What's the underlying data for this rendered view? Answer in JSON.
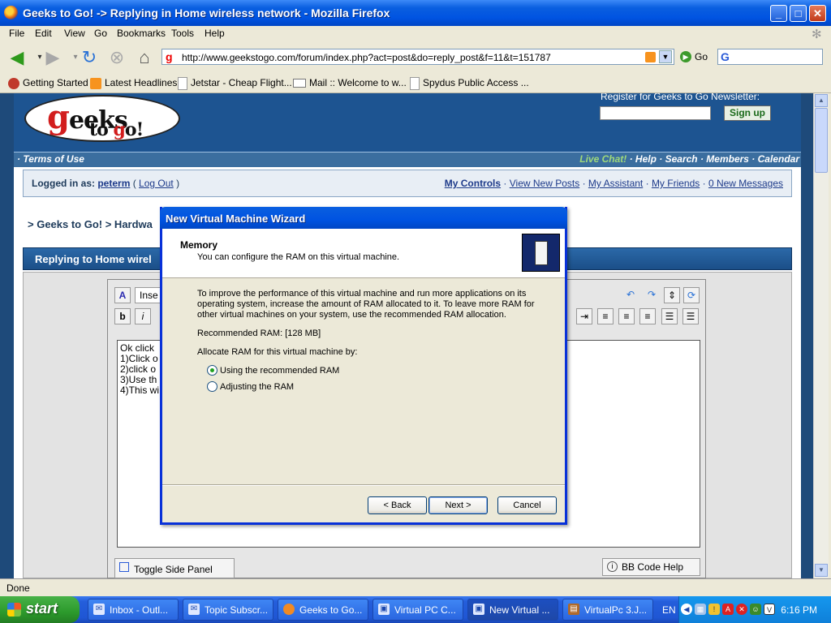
{
  "window": {
    "title": "Geeks to Go! -> Replying in Home wireless network - Mozilla Firefox"
  },
  "menu": [
    "File",
    "Edit",
    "View",
    "Go",
    "Bookmarks",
    "Tools",
    "Help"
  ],
  "nav": {
    "url": "http://www.geekstogo.com/forum/index.php?act=post&do=reply_post&f=11&t=151787",
    "go_label": "Go",
    "search_placeholder": ""
  },
  "bookmarks": [
    {
      "label": "Getting Started",
      "icon": "firefox-icon"
    },
    {
      "label": "Latest Headlines",
      "icon": "rss-icon"
    },
    {
      "label": "Jetstar - Cheap Flight...",
      "icon": "page-icon"
    },
    {
      "label": "Mail :: Welcome to w...",
      "icon": "mail-icon"
    },
    {
      "label": "Spydus Public Access ...",
      "icon": "page-icon"
    }
  ],
  "site": {
    "logo_text": "geeks to go!",
    "newsletter_label": "Register for Geeks to Go Newsletter:",
    "signup": "Sign up",
    "nav_left": "· Terms of Use",
    "nav_live": "Live Chat!",
    "nav_right": " · Help · Search · Members · Calendar",
    "logged_in_prefix": "Logged in as:",
    "username": "peterm",
    "logout": "Log Out",
    "controls": [
      "My Controls",
      "View New Posts",
      "My Assistant",
      "My Friends",
      "0 New Messages"
    ],
    "breadcrumb": "> Geeks to Go! > Hardwa",
    "reply_header": "Replying to Home wirel",
    "editor_font": "Inse",
    "text_lines": [
      "Ok click",
      "1)Click o",
      "2)click o",
      "3)Use th",
      "4)This wi"
    ],
    "toggle_panel": "Toggle Side Panel",
    "bbcode_help": "BB Code Help"
  },
  "dialog": {
    "title": "New Virtual Machine Wizard",
    "heading": "Memory",
    "subheading": "You can configure the RAM on this virtual machine.",
    "para1": "To improve the performance of this virtual machine and run more applications on its",
    "para2": "operating system, increase the amount of RAM allocated to it. To leave more RAM for",
    "para3": "other virtual machines on your system, use the recommended RAM allocation.",
    "recommended": "Recommended RAM: [128 MB]",
    "allocate_label": "Allocate RAM for this virtual machine by:",
    "option1": "Using the recommended RAM",
    "option2": "Adjusting the RAM",
    "selected_option": 1,
    "back": "< Back",
    "next": "Next >",
    "cancel": "Cancel"
  },
  "status": {
    "text": "Done"
  },
  "taskbar": {
    "start": "start",
    "tasks": [
      "Inbox - Outl...",
      "Topic Subscr...",
      "Geeks to Go...",
      "Virtual PC C...",
      "New Virtual ...",
      "VirtualPc 3.J..."
    ],
    "active_task": 4,
    "lang": "EN",
    "clock": "6:16 PM"
  }
}
